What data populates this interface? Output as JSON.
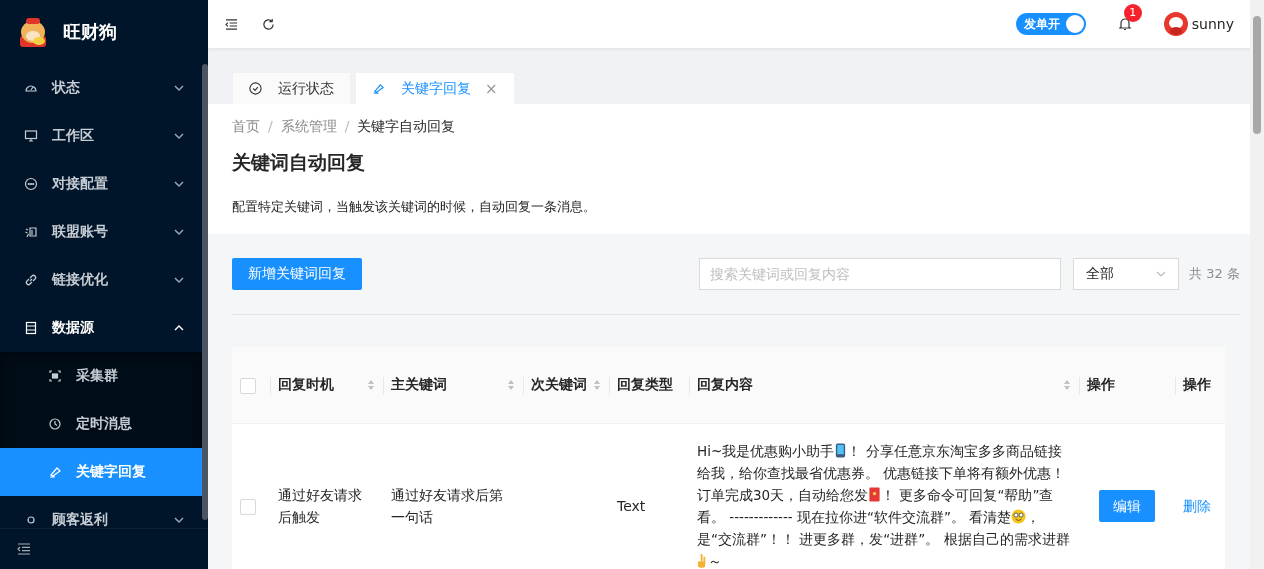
{
  "brand": {
    "name": "旺财狗"
  },
  "sidebar": {
    "items": [
      {
        "label": "状态",
        "expanded": false
      },
      {
        "label": "工作区",
        "expanded": false
      },
      {
        "label": "对接配置",
        "expanded": false
      },
      {
        "label": "联盟账号",
        "expanded": false
      },
      {
        "label": "链接优化",
        "expanded": false
      },
      {
        "label": "数据源",
        "expanded": true,
        "children": [
          {
            "label": "采集群",
            "selected": false
          },
          {
            "label": "定时消息",
            "selected": false
          },
          {
            "label": "关键字回复",
            "selected": true
          }
        ]
      },
      {
        "label": "顾客返利",
        "expanded": false
      }
    ]
  },
  "header": {
    "switch": {
      "label": "发单开",
      "on": true
    },
    "notifications": "1",
    "user": "sunny"
  },
  "tabs": [
    {
      "label": "运行状态",
      "selected": false
    },
    {
      "label": "关键字回复",
      "selected": true
    }
  ],
  "close_glyph": "×",
  "breadcrumb": [
    "首页",
    "系统管理",
    "关键字自动回复"
  ],
  "breadcrumb_separator": "/",
  "page": {
    "title": "关键词自动回复",
    "description": "配置特定关键词，当触发该关键词的时候，自动回复一条消息。"
  },
  "toolbar": {
    "add_button": "新增关键词回复",
    "search_placeholder": "搜索关键词或回复内容",
    "filter": "全部",
    "total": "共 32 条"
  },
  "table": {
    "all_checked": false,
    "columns": [
      {
        "label": "回复时机",
        "sortable": true
      },
      {
        "label": "主关键词",
        "sortable": true
      },
      {
        "label": "次关键词",
        "sortable": true
      },
      {
        "label": "回复类型",
        "sortable": false
      },
      {
        "label": "回复内容",
        "sortable": true
      },
      {
        "label": "操作",
        "sortable": false
      },
      {
        "label": "操作",
        "sortable": false
      }
    ],
    "rows": [
      {
        "checked": false,
        "timing": "通过好友请求后触发",
        "main_keyword": "通过好友请求后第一句话",
        "type": "Text",
        "content": [
          {
            "kind": "text",
            "text": "Hi~我是优惠购小助手"
          },
          {
            "kind": "phone"
          },
          {
            "kind": "text",
            "text": "！ 分享任意京东淘宝多多商品链接给我，给你查找最省优惠券。 优惠链接下单将有额外优惠！订单完成30天，自动给您发"
          },
          {
            "kind": "envelope"
          },
          {
            "kind": "text",
            "text": "！ 更多命令可回复“帮助”查看。 ------------- 现在拉你进“软件交流群”。 看清楚"
          },
          {
            "kind": "face"
          },
          {
            "kind": "text",
            "text": "，是“交流群”！！ 进更多群，发“进群”。 根据自己的需求进群"
          },
          {
            "kind": "hand"
          },
          {
            "kind": "text",
            "text": "～"
          }
        ],
        "edit": "编辑",
        "delete": "删除"
      }
    ]
  }
}
